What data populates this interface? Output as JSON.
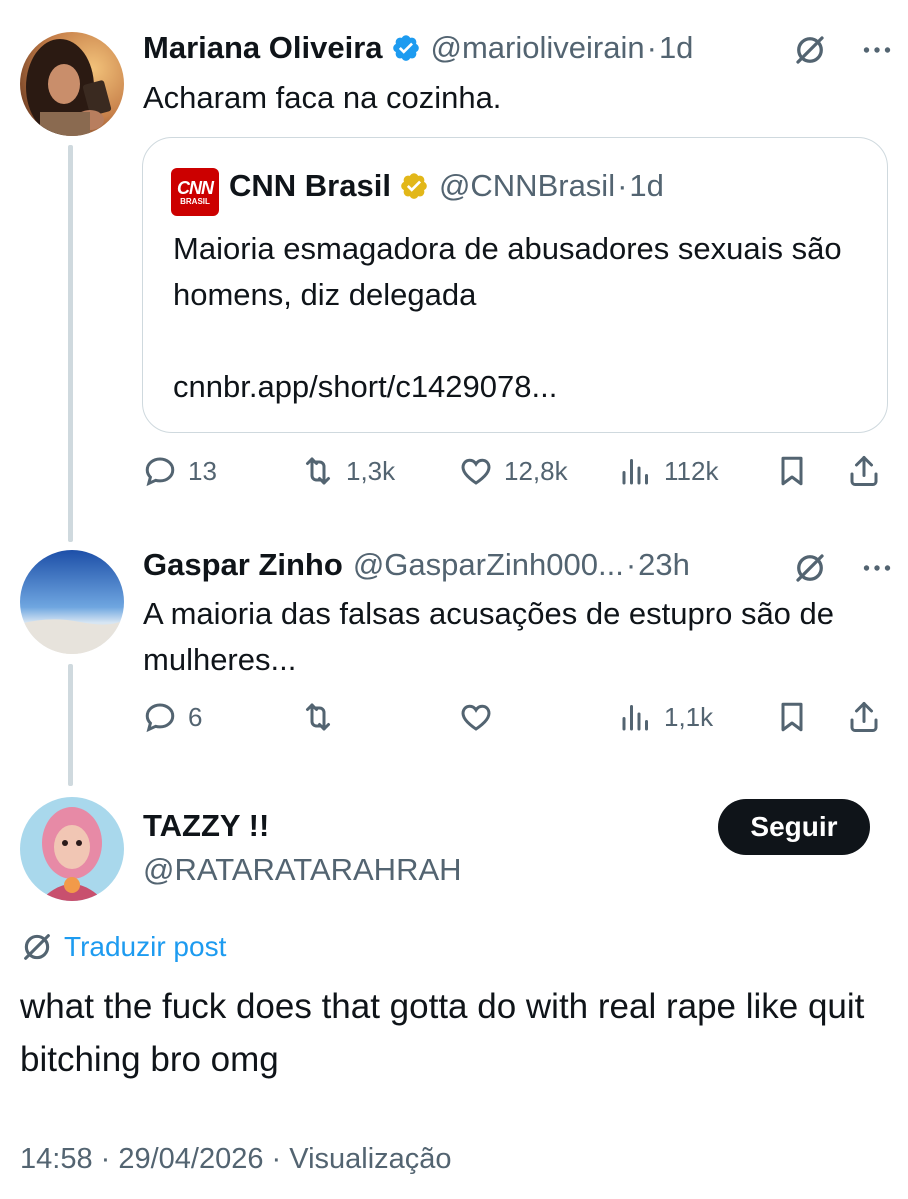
{
  "tweet1": {
    "name": "Mariana Oliveira",
    "handle": "@marioliveirain",
    "time": "1d",
    "text": "Acharam faca na cozinha.",
    "quote": {
      "name": "CNN Brasil",
      "handle": "@CNNBrasil",
      "time": "1d",
      "logo_top": "CNN",
      "logo_bottom": "BRASIL",
      "text": "Maioria esmagadora de abusadores sexuais são homens, diz delegada",
      "link": "cnnbr.app/short/c1429078..."
    },
    "replies": "13",
    "reposts": "1,3k",
    "likes": "12,8k",
    "views": "112k"
  },
  "tweet2": {
    "name": "Gaspar Zinho",
    "handle": "@GasparZinh000...",
    "time": "23h",
    "text": "A maioria das falsas acusações de estupro são de mulheres...",
    "replies": "6",
    "views": "1,1k"
  },
  "main": {
    "name": "TAZZY !!",
    "handle": "@RATARATARAHRAH",
    "follow_label": "Seguir",
    "translate_label": "Traduzir post",
    "text": "what the fuck does that gotta do with real rape like quit bitching bro omg",
    "footer": "14:58 · 29/04/2026 · Visualização"
  },
  "colors": {
    "verified_blue": "#1d9bf0",
    "verified_gold": "#e2b719",
    "cnn_red": "#cc0000",
    "link_blue": "#1d9bf0"
  },
  "icons": [
    "translate-icon",
    "more-icon",
    "reply-icon",
    "repost-icon",
    "like-icon",
    "views-icon",
    "bookmark-icon",
    "share-icon",
    "verified-icon"
  ]
}
